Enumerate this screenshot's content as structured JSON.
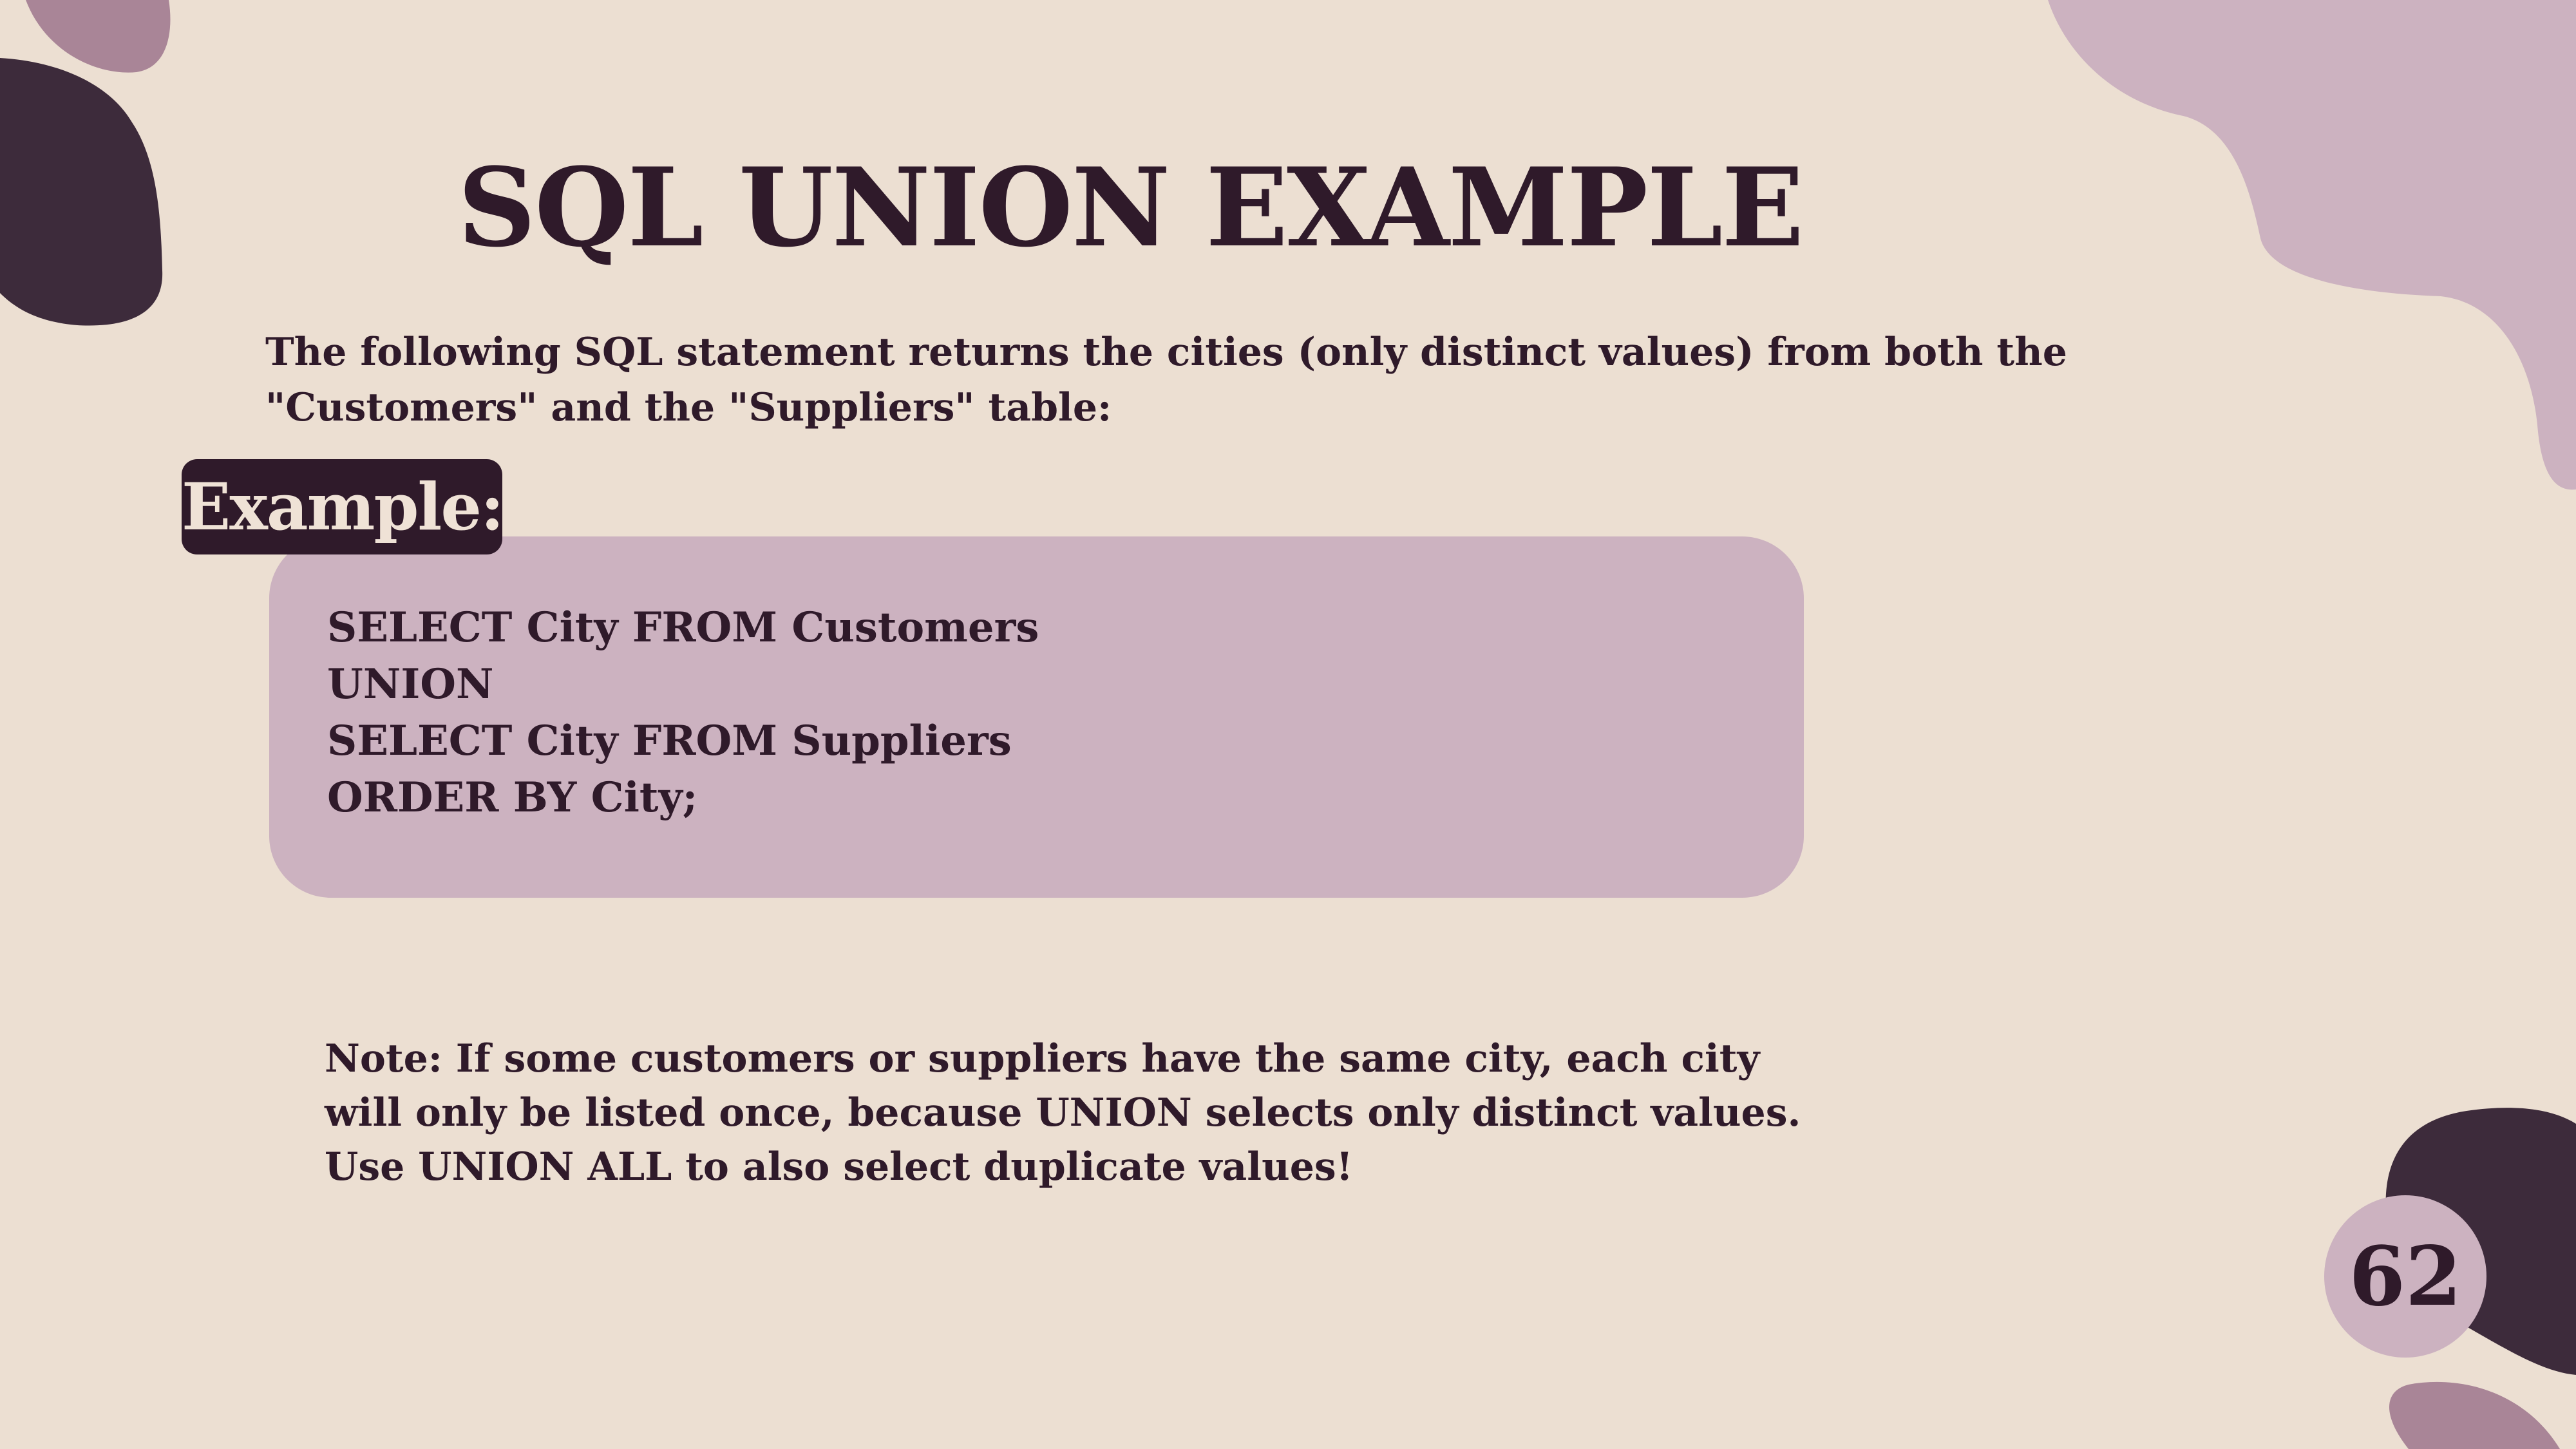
{
  "slide": {
    "title": "SQL UNION EXAMPLE",
    "intro": "The following SQL statement returns the cities (only distinct values) from both the \"Customers\" and the \"Suppliers\" table:",
    "example_label": "Example:",
    "code_lines": [
      "SELECT City FROM Customers",
      "UNION",
      "SELECT City FROM Suppliers",
      "ORDER BY City;"
    ],
    "note": "Note: If some customers or suppliers have the same city, each city will only be listed once, because UNION selects only distinct values. Use UNION ALL to also select duplicate values!",
    "page_number": "62"
  },
  "colors": {
    "background": "#ecdfd2",
    "dark_plum": "#2f1a2a",
    "light_mauve": "#ccb2c0",
    "mauve": "#a98597",
    "label_text": "#efe2d6"
  }
}
